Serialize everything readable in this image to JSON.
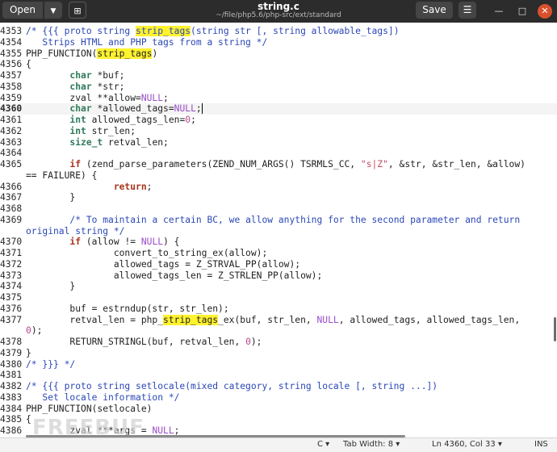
{
  "header": {
    "open_label": "Open",
    "title": "string.c",
    "path": "~/file/php5.6/php-src/ext/standard",
    "save_label": "Save"
  },
  "lines": [
    {
      "n": "4353",
      "parts": [
        [
          "cm",
          "/* {{{ proto string "
        ],
        [
          "cm hl",
          "strip_tags"
        ],
        [
          "cm",
          "(string str [, string allowable_tags])"
        ]
      ]
    },
    {
      "n": "4354",
      "parts": [
        [
          "cm",
          "   Strips HTML and PHP tags from a string */"
        ]
      ]
    },
    {
      "n": "4355",
      "parts": [
        [
          "",
          "PHP_FUNCTION("
        ],
        [
          "hl",
          "strip_tags"
        ],
        [
          "",
          ")"
        ]
      ]
    },
    {
      "n": "4356",
      "parts": [
        [
          "",
          "{"
        ]
      ]
    },
    {
      "n": "4357",
      "parts": [
        [
          "",
          "        "
        ],
        [
          "kw",
          "char"
        ],
        [
          "",
          " *buf;"
        ]
      ]
    },
    {
      "n": "4358",
      "parts": [
        [
          "",
          "        "
        ],
        [
          "kw",
          "char"
        ],
        [
          "",
          " *str;"
        ]
      ]
    },
    {
      "n": "4359",
      "parts": [
        [
          "",
          "        zval **allow="
        ],
        [
          "nul",
          "NULL"
        ],
        [
          "",
          ";"
        ]
      ]
    },
    {
      "n": "4360",
      "cur": true,
      "parts": [
        [
          "",
          "        "
        ],
        [
          "kw",
          "char"
        ],
        [
          "",
          " *allowed_tags="
        ],
        [
          "nul",
          "NULL"
        ],
        [
          "",
          ";"
        ]
      ]
    },
    {
      "n": "4361",
      "parts": [
        [
          "",
          "        "
        ],
        [
          "kw",
          "int"
        ],
        [
          "",
          " allowed_tags_len="
        ],
        [
          "num",
          "0"
        ],
        [
          "",
          ";"
        ]
      ]
    },
    {
      "n": "4362",
      "parts": [
        [
          "",
          "        "
        ],
        [
          "kw",
          "int"
        ],
        [
          "",
          " str_len;"
        ]
      ]
    },
    {
      "n": "4363",
      "parts": [
        [
          "",
          "        "
        ],
        [
          "kw",
          "size_t"
        ],
        [
          "",
          " retval_len;"
        ]
      ]
    },
    {
      "n": "4364",
      "parts": []
    },
    {
      "n": "4365",
      "parts": [
        [
          "",
          "        "
        ],
        [
          "kw2",
          "if"
        ],
        [
          "",
          " (zend_parse_parameters(ZEND_NUM_ARGS() TSRMLS_CC, "
        ],
        [
          "str",
          "\"s|Z\""
        ],
        [
          "",
          ", &str, &str_len, &allow)"
        ]
      ],
      "cont": [
        [
          "",
          "== FAILURE) {"
        ]
      ]
    },
    {
      "n": "4366",
      "parts": [
        [
          "",
          "                "
        ],
        [
          "kw2",
          "return"
        ],
        [
          "",
          ";"
        ]
      ]
    },
    {
      "n": "4367",
      "parts": [
        [
          "",
          "        }"
        ]
      ]
    },
    {
      "n": "4368",
      "parts": []
    },
    {
      "n": "4369",
      "parts": [
        [
          "",
          "        "
        ],
        [
          "cm",
          "/* To maintain a certain BC, we allow anything for the second parameter and return"
        ]
      ],
      "cont": [
        [
          "cm",
          "original string */"
        ]
      ]
    },
    {
      "n": "4370",
      "parts": [
        [
          "",
          "        "
        ],
        [
          "kw2",
          "if"
        ],
        [
          "",
          " (allow != "
        ],
        [
          "nul",
          "NULL"
        ],
        [
          "",
          ") {"
        ]
      ]
    },
    {
      "n": "4371",
      "parts": [
        [
          "",
          "                convert_to_string_ex(allow);"
        ]
      ]
    },
    {
      "n": "4372",
      "parts": [
        [
          "",
          "                allowed_tags = Z_STRVAL_PP(allow);"
        ]
      ]
    },
    {
      "n": "4373",
      "parts": [
        [
          "",
          "                allowed_tags_len = Z_STRLEN_PP(allow);"
        ]
      ]
    },
    {
      "n": "4374",
      "parts": [
        [
          "",
          "        }"
        ]
      ]
    },
    {
      "n": "4375",
      "parts": []
    },
    {
      "n": "4376",
      "parts": [
        [
          "",
          "        buf = estrndup(str, str_len);"
        ]
      ]
    },
    {
      "n": "4377",
      "parts": [
        [
          "",
          "        retval_len = php_"
        ],
        [
          "hl",
          "strip_tags"
        ],
        [
          "",
          "_ex(buf, str_len, "
        ],
        [
          "nul",
          "NULL"
        ],
        [
          "",
          ", allowed_tags, allowed_tags_len,"
        ]
      ],
      "cont": [
        [
          "num",
          "0"
        ],
        [
          "",
          ");"
        ]
      ]
    },
    {
      "n": "4378",
      "parts": [
        [
          "",
          "        RETURN_STRINGL(buf, retval_len, "
        ],
        [
          "num",
          "0"
        ],
        [
          "",
          ");"
        ]
      ]
    },
    {
      "n": "4379",
      "parts": [
        [
          "",
          "}"
        ]
      ]
    },
    {
      "n": "4380",
      "parts": [
        [
          "cm",
          "/* }}} */"
        ]
      ]
    },
    {
      "n": "4381",
      "parts": []
    },
    {
      "n": "4382",
      "parts": [
        [
          "cm",
          "/* {{{ proto string setlocale(mixed category, string locale [, string ...])"
        ]
      ]
    },
    {
      "n": "4383",
      "parts": [
        [
          "cm",
          "   Set locale information */"
        ]
      ]
    },
    {
      "n": "4384",
      "parts": [
        [
          "",
          "PHP_FUNCTION(setlocale)"
        ]
      ]
    },
    {
      "n": "4385",
      "parts": [
        [
          "",
          "{"
        ]
      ]
    },
    {
      "n": "4386",
      "parts": [
        [
          "",
          "        zval ***args = "
        ],
        [
          "nul",
          "NULL"
        ],
        [
          "",
          ";"
        ]
      ]
    }
  ],
  "status": {
    "language": "C",
    "tab_width": "Tab Width: 8",
    "position": "Ln 4360, Col 33",
    "mode": "INS"
  },
  "watermark": "FREEBUF"
}
